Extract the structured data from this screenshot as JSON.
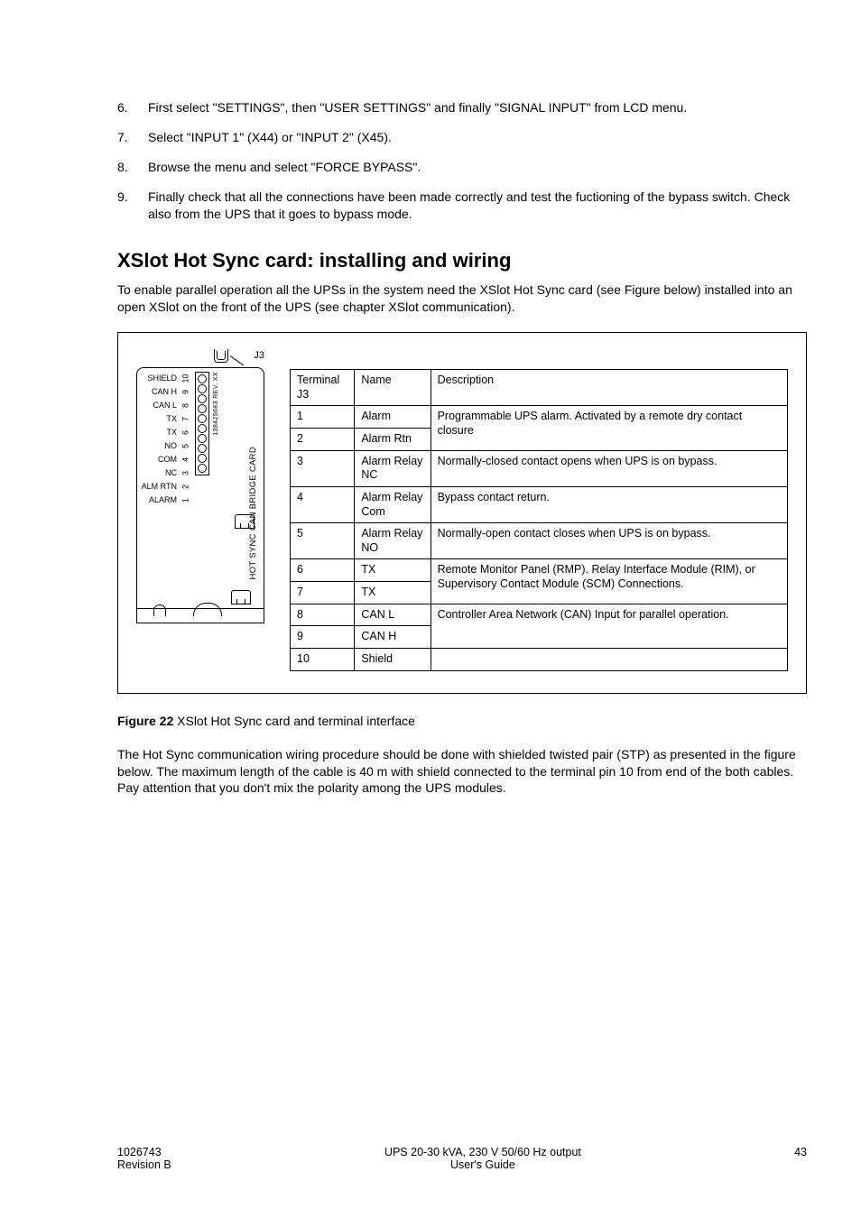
{
  "steps": [
    {
      "n": "6.",
      "t": "First select \"SETTINGS\", then \"USER SETTINGS\" and finally \"SIGNAL INPUT\" from LCD menu."
    },
    {
      "n": "7.",
      "t": "Select \"INPUT 1\" (X44) or \"INPUT 2\" (X45)."
    },
    {
      "n": "8.",
      "t": "Browse the menu and select \"FORCE BYPASS\"."
    },
    {
      "n": "9.",
      "t": "Finally check that all the connections have been made correctly and test the fuctioning of the bypass switch. Check also from the UPS that it goes to bypass mode."
    }
  ],
  "section_title": "XSlot Hot Sync card: installing and wiring",
  "section_desc": "To enable parallel operation all the UPSs in the system need the XSlot Hot Sync card (see Figure below) installed into an open XSlot on the front of the UPS (see chapter XSlot communication).",
  "diagram": {
    "connector_label": "J3",
    "pin_labels": [
      "SHIELD",
      "CAN H",
      "CAN L",
      "TX",
      "TX",
      "NO",
      "COM",
      "NC",
      "ALM RTN",
      "ALARM"
    ],
    "pin_numbers": [
      "10",
      "9",
      "8",
      "7",
      "6",
      "5",
      "4",
      "3",
      "2",
      "1"
    ],
    "side_code": "138425683 REV. XX",
    "side_name": "HOT SYNC CAN BRIDGE CARD"
  },
  "table": {
    "headers": [
      "Terminal J3",
      "Name",
      "Description"
    ],
    "rows": [
      {
        "t": "1",
        "n": "Alarm",
        "d": "Programmable UPS alarm. Activated by a remote dry contact closure",
        "rs": 2
      },
      {
        "t": "2",
        "n": "Alarm Rtn"
      },
      {
        "t": "3",
        "n": "Alarm Relay NC",
        "d": "Normally-closed contact opens when UPS is on bypass."
      },
      {
        "t": "4",
        "n": "Alarm Relay Com",
        "d": "Bypass contact return."
      },
      {
        "t": "5",
        "n": "Alarm Relay NO",
        "d": "Normally-open contact closes when UPS is on bypass."
      },
      {
        "t": "6",
        "n": "TX",
        "d": "Remote Monitor Panel (RMP). Relay Interface Module (RIM), or Supervisory Contact Module (SCM) Connections.",
        "rs": 2
      },
      {
        "t": "7",
        "n": "TX"
      },
      {
        "t": "8",
        "n": "CAN L",
        "d": "Controller Area Network (CAN) Input for parallel operation.",
        "rs": 2
      },
      {
        "t": "9",
        "n": "CAN H"
      },
      {
        "t": "10",
        "n": "Shield",
        "d": ""
      }
    ]
  },
  "figure_caption_bold": "Figure 22",
  "figure_caption_rest": "  XSlot Hot Sync card and terminal interface",
  "after_fig": "The Hot Sync communication wiring procedure should be done with shielded twisted pair (STP) as presented in the figure below. The maximum length of the cable  is 40 m with shield connected to the terminal pin 10 from end of the both cables. Pay attention that you don't mix the polarity among the UPS modules.",
  "footer": {
    "left1": "1026743",
    "left2": "Revision B",
    "mid1": "UPS 20-30 kVA, 230 V 50/60 Hz output",
    "mid2": "User's Guide",
    "right": "43"
  }
}
